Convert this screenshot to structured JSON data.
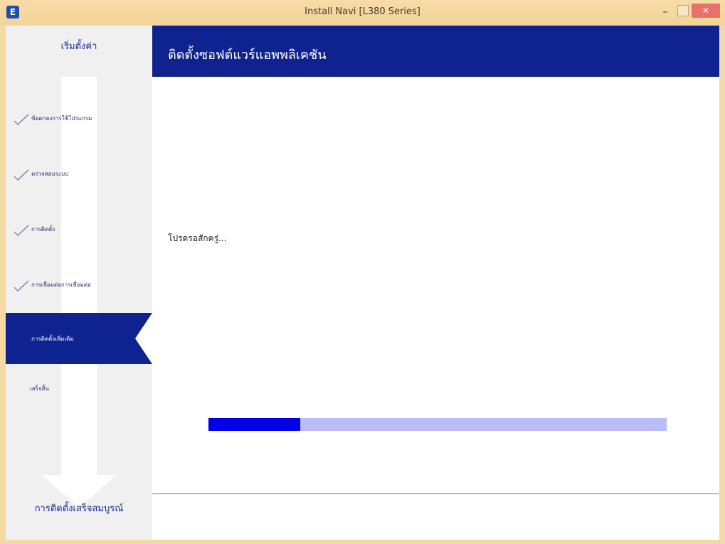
{
  "window": {
    "title": "Install Navi [L380 Series]",
    "app_icon_glyph": "E",
    "min_glyph": "–",
    "close_glyph": "✕"
  },
  "sidebar": {
    "top_label": "เริ่มตั้งค่า",
    "steps": [
      {
        "label": "ข้อตกลงการใช้โปรแกรม",
        "state": "done"
      },
      {
        "label": "ตรวจสอบระบบ",
        "state": "done"
      },
      {
        "label": "การติดตั้ง",
        "state": "done"
      },
      {
        "label": "การเชื่อมต่อการเชื่อมต่อ",
        "state": "done"
      },
      {
        "label": "การติดตั้งเพิ่มเติม",
        "state": "active"
      },
      {
        "label": "เสร็จสิ้น",
        "state": "pending"
      }
    ],
    "bottom_label": "การติดตั้งเสร็จสมบูรณ์"
  },
  "header": {
    "title": "ติดตั้งซอฟต์แวร์แอพพลิเคชัน"
  },
  "content": {
    "status": "โปรดรอสักครู่...",
    "progress_fraction": 0.2
  },
  "colors": {
    "header_bg": "#0f2390",
    "progress_fill": "#0000e6",
    "progress_track": "#babcf7",
    "titlebar": "#f5d9a4"
  }
}
